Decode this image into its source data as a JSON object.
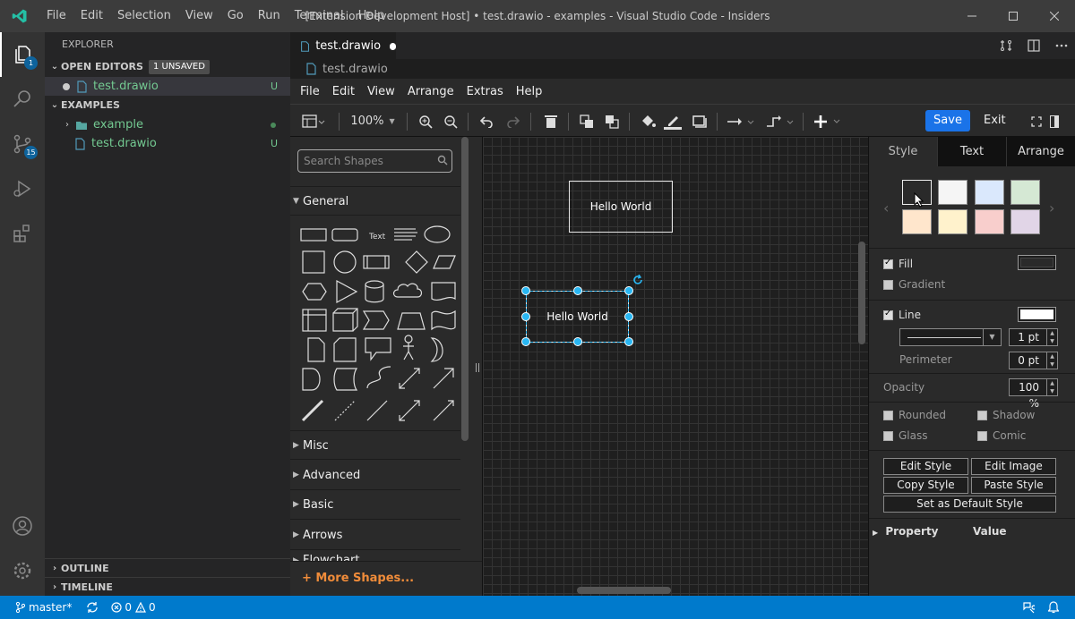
{
  "titlebar": {
    "menu": [
      "File",
      "Edit",
      "Selection",
      "View",
      "Go",
      "Run",
      "Terminal",
      "Help"
    ],
    "title": "[Extension Development Host] • test.drawio - examples - Visual Studio Code - Insiders"
  },
  "activity": {
    "explorer_badge": "1",
    "scm_badge": "15"
  },
  "sidebar": {
    "header": "EXPLORER",
    "open_editors": "OPEN EDITORS",
    "unsaved_badge": "1 UNSAVED",
    "open_file": "test.drawio",
    "open_file_status": "U",
    "examples": "EXAMPLES",
    "folder": "example",
    "file": "test.drawio",
    "file_status": "U",
    "outline": "OUTLINE",
    "timeline": "TIMELINE"
  },
  "editor": {
    "tab_label": "test.drawio",
    "breadcrumb": "test.drawio"
  },
  "drawio": {
    "menu": [
      "File",
      "Edit",
      "View",
      "Arrange",
      "Extras",
      "Help"
    ],
    "zoom": "100%",
    "save": "Save",
    "exit": "Exit",
    "search_placeholder": "Search Shapes",
    "general": "General",
    "text_shape": "Text",
    "categories": [
      "Misc",
      "Advanced",
      "Basic",
      "Arrows",
      "Flowchart"
    ],
    "more_shapes": "+ More Shapes...",
    "node1": "Hello World",
    "node2": "Hello World",
    "format_tabs": [
      "Style",
      "Text",
      "Arrange"
    ],
    "fill": "Fill",
    "gradient": "Gradient",
    "line": "Line",
    "line_width": "1 pt",
    "perimeter": "Perimeter",
    "perimeter_value": "0 pt",
    "opacity": "Opacity",
    "opacity_value": "100 %",
    "rounded": "Rounded",
    "shadow": "Shadow",
    "glass": "Glass",
    "comic": "Comic",
    "edit_style": "Edit Style",
    "edit_image": "Edit Image",
    "copy_style": "Copy Style",
    "paste_style": "Paste Style",
    "set_default": "Set as Default Style",
    "property": "Property",
    "value": "Value",
    "swatches": [
      "#2a2a2a",
      "#f5f5f5",
      "#dae8fc",
      "#d5e8d4",
      "#ffe6cc",
      "#fff2cc",
      "#f8cecc",
      "#e1d5e7"
    ]
  },
  "status": {
    "branch": "master*",
    "errors": "0",
    "warnings": "0"
  }
}
